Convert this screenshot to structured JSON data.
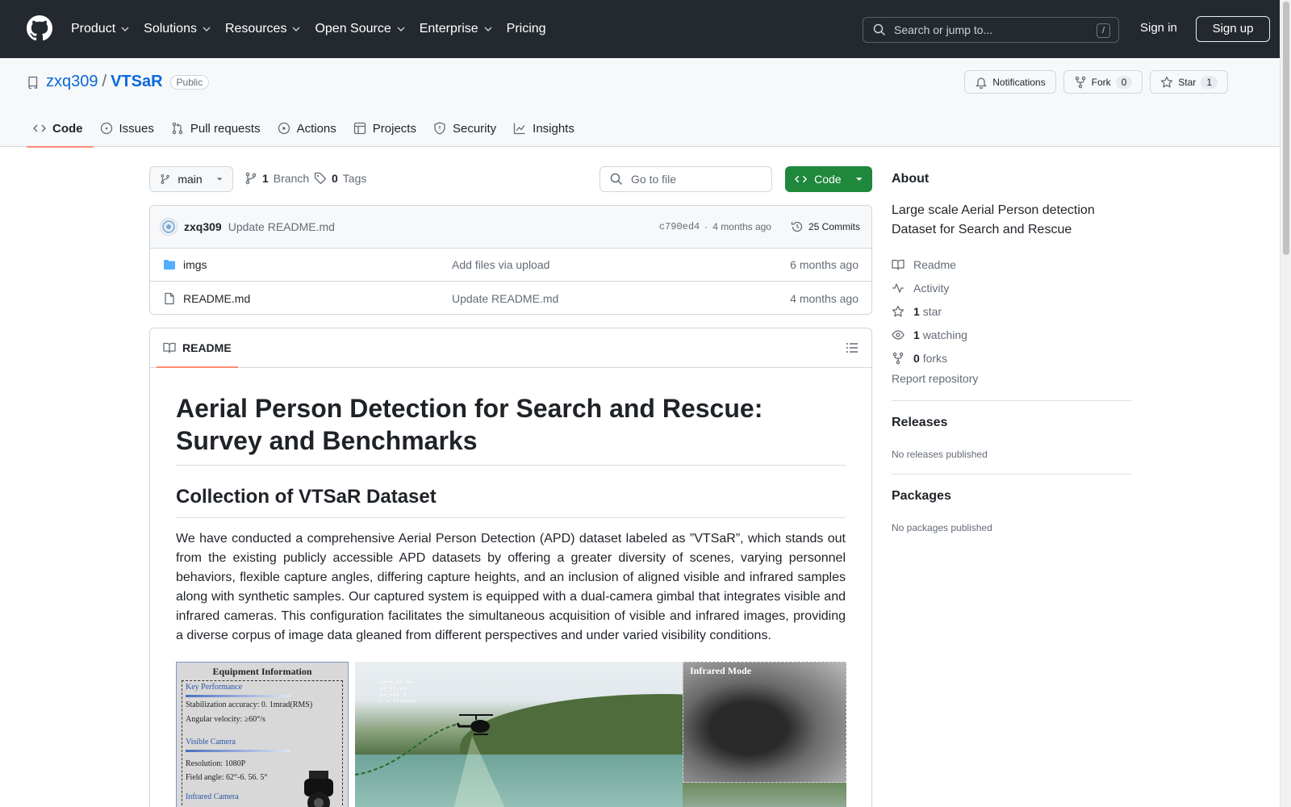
{
  "global_nav": {
    "items": [
      "Product",
      "Solutions",
      "Resources",
      "Open Source",
      "Enterprise",
      "Pricing"
    ],
    "search_placeholder": "Search or jump to...",
    "search_shortcut": "/",
    "signin": "Sign in",
    "signup": "Sign up"
  },
  "repo": {
    "owner": "zxq309",
    "separator": "/",
    "name": "VTSaR",
    "visibility": "Public",
    "notifications": "Notifications",
    "fork_label": "Fork",
    "fork_count": "0",
    "star_label": "Star",
    "star_count": "1",
    "tabs": [
      "Code",
      "Issues",
      "Pull requests",
      "Actions",
      "Projects",
      "Security",
      "Insights"
    ]
  },
  "toolbar": {
    "branch": "main",
    "branch_count": "1",
    "branch_label": "Branch",
    "tag_count": "0",
    "tag_label": "Tags",
    "goto_placeholder": "Go to file",
    "code_button": "Code"
  },
  "latest_commit": {
    "author": "zxq309",
    "message": "Update README.md",
    "hash": "c790ed4",
    "dot": "·",
    "time": "4 months ago",
    "commits_label": "25 Commits"
  },
  "files": [
    {
      "name": "imgs",
      "type": "folder",
      "message": "Add files via upload",
      "date": "6 months ago"
    },
    {
      "name": "README.md",
      "type": "file",
      "message": "Update README.md",
      "date": "4 months ago"
    }
  ],
  "readme": {
    "tab": "README",
    "title": "Aerial Person Detection for Search and Rescue: Survey and Benchmarks",
    "h2": "Collection of VTSaR Dataset",
    "paragraph": "We have conducted a comprehensive Aerial Person Detection (APD) dataset labeled as ”VTSaR”, which stands out from the existing publicly accessible APD datasets by offering a greater diversity of scenes, varying personnel behaviors, flexible capture angles, differing capture heights, and an inclusion of aligned visible and infrared samples along with synthetic samples. Our captured system is equipped with a dual-camera gimbal that integrates visible and infrared cameras. This configuration facilitates the simultaneous acquisition of visible and infrared images, providing a diverse corpus of image data gleaned from different perspectives and under varied visibility conditions.",
    "figure": {
      "equipment_title": "Equipment  Information",
      "key_perf": "Key Performance",
      "stab": "Stabilization  accuracy: 0. 1mrad(RMS)",
      "ang": "Angular  velocity: ≥60°/s",
      "visible_cam": "Visible  Camera",
      "res": "Resolution: 1080P",
      "field": "Field  angle: 62°-6. 56. 5°",
      "ir_cam": "Infrared  Camera",
      "ir_mode": "Infrared  Mode"
    }
  },
  "sidebar": {
    "about_title": "About",
    "description": "Large scale Aerial Person detection Dataset for Search and Rescue",
    "links": [
      {
        "icon": "book-icon",
        "count": "",
        "label": "Readme"
      },
      {
        "icon": "pulse-icon",
        "count": "",
        "label": "Activity"
      },
      {
        "icon": "star-icon",
        "count": "1",
        "label": "star"
      },
      {
        "icon": "eye-icon",
        "count": "1",
        "label": "watching"
      },
      {
        "icon": "fork-icon",
        "count": "0",
        "label": "forks"
      }
    ],
    "report": "Report repository",
    "releases_title": "Releases",
    "releases_text": "No releases published",
    "packages_title": "Packages",
    "packages_text": "No packages published"
  },
  "colors": {
    "header_bg": "#24292f",
    "link": "#0969da",
    "code_button": "#1f883d",
    "active_tab": "#fd8c73"
  }
}
